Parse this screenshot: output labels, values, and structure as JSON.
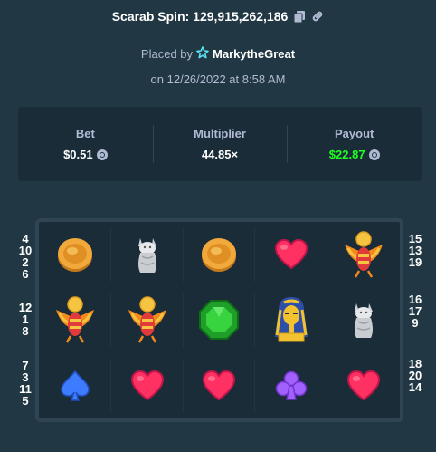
{
  "header": {
    "title": "Scarab Spin: 129,915,262,186",
    "placed_by_prefix": "Placed by",
    "username": "MarkytheGreat",
    "date": "on 12/26/2022 at 8:58 AM"
  },
  "stats": {
    "bet_label": "Bet",
    "bet_value": "$0.51",
    "multiplier_label": "Multiplier",
    "multiplier_value": "44.85×",
    "payout_label": "Payout",
    "payout_value": "$22.87"
  },
  "paylines": {
    "left": [
      [
        "4",
        "10",
        "2",
        "6"
      ],
      [
        "12",
        "1",
        "8"
      ],
      [
        "7",
        "3",
        "11",
        "5"
      ]
    ],
    "right": [
      [
        "15",
        "13",
        "19"
      ],
      [
        "16",
        "17",
        "9"
      ],
      [
        "18",
        "20",
        "14"
      ]
    ]
  },
  "reels": [
    [
      "coin",
      "cat",
      "coin",
      "heart",
      "scarab"
    ],
    [
      "scarab",
      "scarab",
      "gem",
      "pharaoh",
      "cat"
    ],
    [
      "spade",
      "heart",
      "heart",
      "club",
      "heart"
    ]
  ],
  "colors": {
    "background": "#213743",
    "panel": "#1a2c38",
    "payout_green": "#1fff20",
    "muted_text": "#b1bad3"
  }
}
